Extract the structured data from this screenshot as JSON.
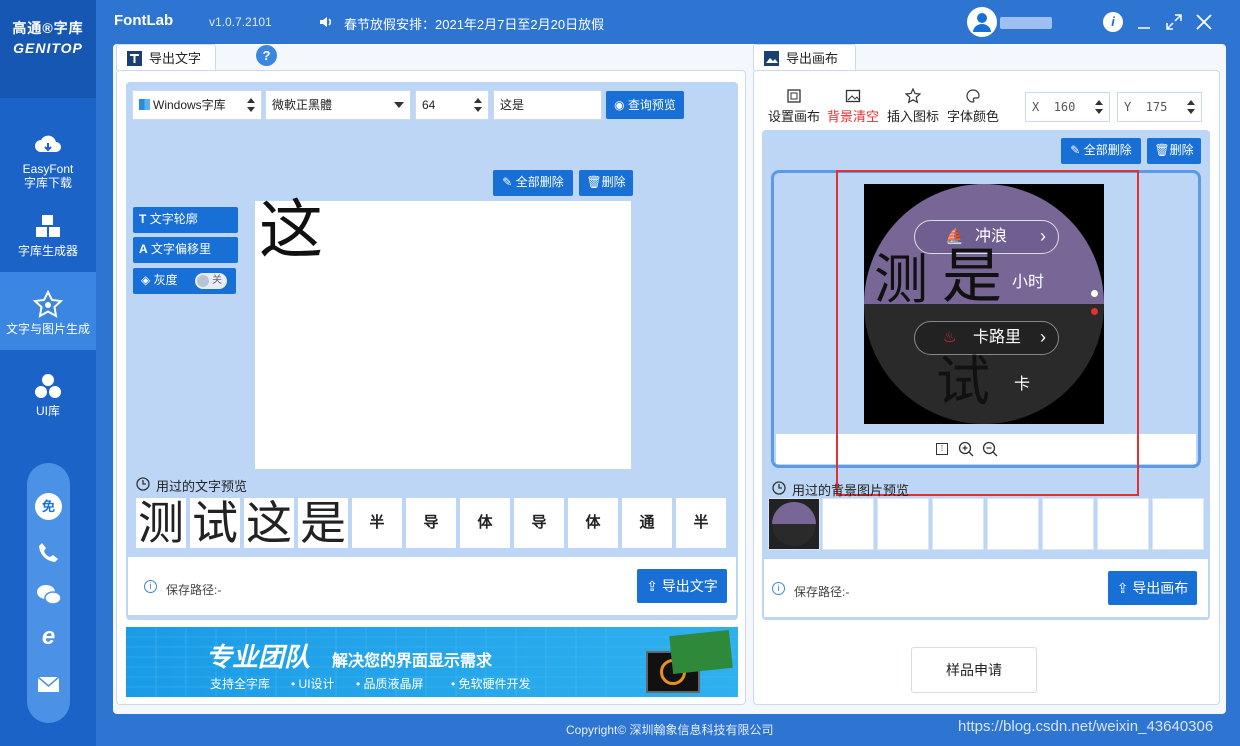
{
  "app": {
    "title": "FontLab",
    "version": "v1.0.7.2101",
    "notice": "春节放假安排：2021年2月7日至2月20日放假"
  },
  "sidebar": {
    "logo_line1": "高通®字库",
    "logo_line2": "GENITOP",
    "items": [
      {
        "label1": "EasyFont",
        "label2": "字库下载",
        "icon": "cloud-icon"
      },
      {
        "label1": "字库生成器",
        "label2": "",
        "icon": "cubes-icon"
      },
      {
        "label1": "文字与图片生成",
        "label2": "",
        "icon": "star-icon"
      },
      {
        "label1": "UI库",
        "label2": "",
        "icon": "circles-icon"
      }
    ],
    "contact": [
      "免",
      "phone-icon",
      "wechat-icon",
      "ie-icon",
      "mail-icon"
    ]
  },
  "left": {
    "tab": "导出文字",
    "font_source": "Windows字库",
    "font_name": "微軟正黑體",
    "font_size": "64",
    "text_input": "这是",
    "preview_btn": "查询预览",
    "clear_all_btn": "全部删除",
    "delete_btn": "删除",
    "outline_btn": "文字轮廓",
    "offset_btn": "文字偏移里",
    "gray_btn": "灰度",
    "gray_toggle": "关",
    "canvas_char": "这",
    "history_title": "用过的文字预览",
    "history": [
      "测",
      "试",
      "这",
      "是",
      "半",
      "导",
      "体",
      "导",
      "体",
      "通",
      "半"
    ],
    "save_label": "保存路径:-",
    "export_btn": "导出文字"
  },
  "right": {
    "tab": "导出画布",
    "tools": [
      "设置画布",
      "背景清空",
      "插入图标",
      "字体颜色"
    ],
    "x_label": "X",
    "x_value": "160",
    "y_label": "Y",
    "y_value": "175",
    "clear_all_btn": "全部删除",
    "delete_btn": "删除",
    "canvas": {
      "btn1": "冲浪",
      "btn2": "卡路里",
      "char1": "测",
      "char2": "是",
      "char3": "试",
      "unit1": "小时",
      "unit2": "卡"
    },
    "history_title": "用过的背景图片预览",
    "save_label": "保存路径:-",
    "export_btn": "导出画布",
    "sample_btn": "样品申请"
  },
  "banner": {
    "title": "专业团队",
    "subtitle": "解决您的界面显示需求",
    "items": [
      "支持全字库",
      "UI设计",
      "品质液晶屏",
      "免软硬件开发"
    ]
  },
  "footer": {
    "copyright": "Copyright©  深圳翰象信息科技有限公司",
    "watermark": "https://blog.csdn.net/weixin_43640306"
  },
  "colors": {
    "accent": "#1870d6",
    "sidebar": "#1b63c6",
    "highlight": "#e53030"
  }
}
